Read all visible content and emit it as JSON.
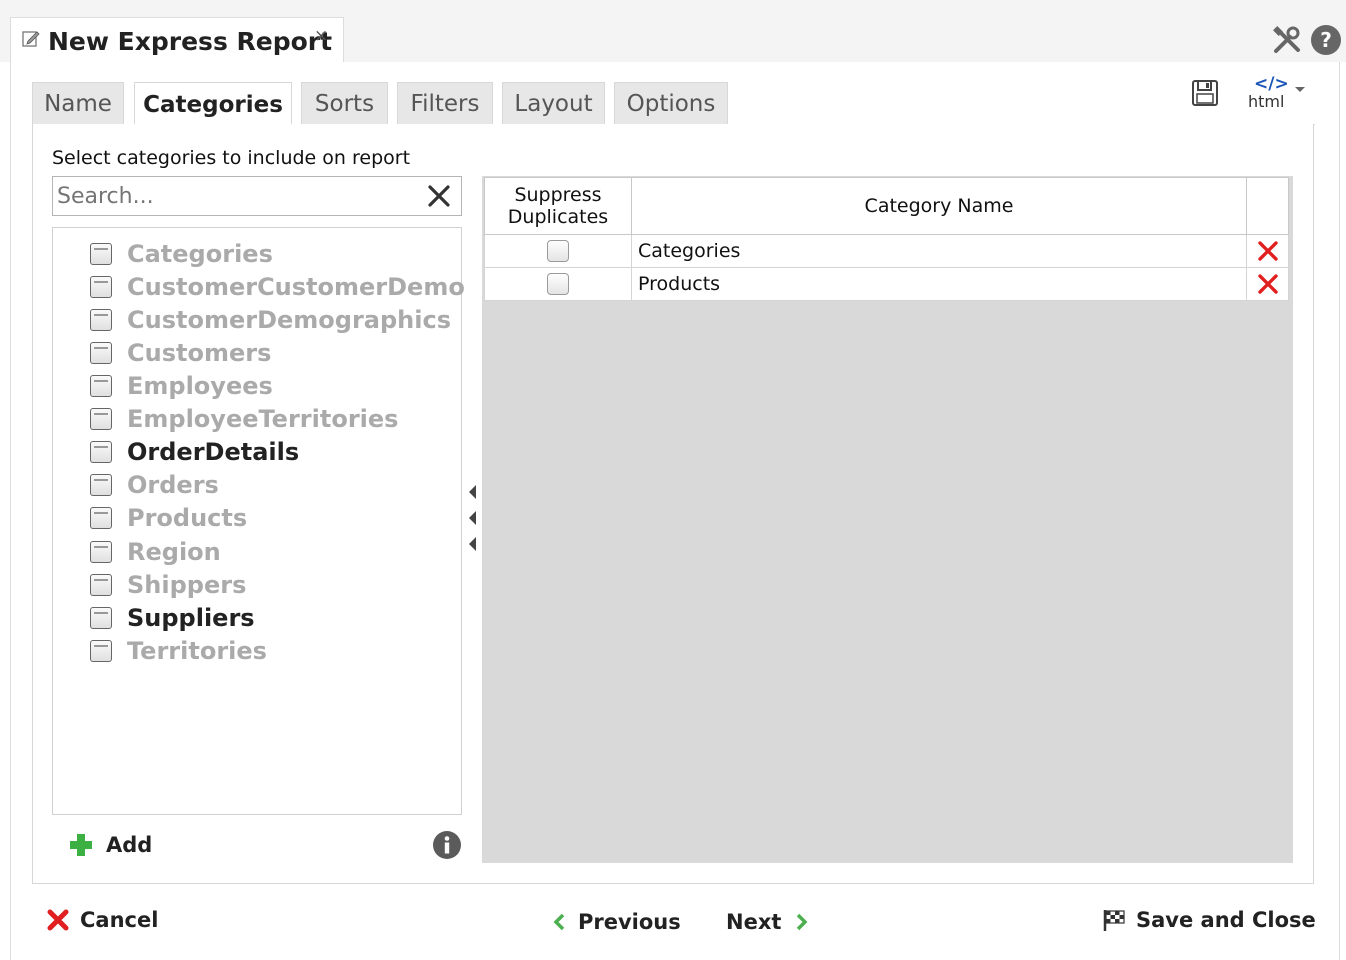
{
  "window": {
    "title": "New Express Report",
    "close_label": "×"
  },
  "tabs": [
    {
      "label": "Name"
    },
    {
      "label": "Categories"
    },
    {
      "label": "Sorts"
    },
    {
      "label": "Filters"
    },
    {
      "label": "Layout"
    },
    {
      "label": "Options"
    }
  ],
  "active_tab": "Categories",
  "toolbar": {
    "html_label": "html",
    "html_code_label": "</>"
  },
  "left": {
    "instructions": "Select categories to include on report",
    "search_placeholder": "Search...",
    "items": [
      {
        "label": "Categories",
        "emphasized": false
      },
      {
        "label": "CustomerCustomerDemo",
        "emphasized": false
      },
      {
        "label": "CustomerDemographics",
        "emphasized": false
      },
      {
        "label": "Customers",
        "emphasized": false
      },
      {
        "label": "Employees",
        "emphasized": false
      },
      {
        "label": "EmployeeTerritories",
        "emphasized": false
      },
      {
        "label": "OrderDetails",
        "emphasized": true
      },
      {
        "label": "Orders",
        "emphasized": false
      },
      {
        "label": "Products",
        "emphasized": false
      },
      {
        "label": "Region",
        "emphasized": false
      },
      {
        "label": "Shippers",
        "emphasized": false
      },
      {
        "label": "Suppliers",
        "emphasized": true
      },
      {
        "label": "Territories",
        "emphasized": false
      }
    ],
    "add_label": "Add"
  },
  "grid": {
    "headers": {
      "suppress_line1": "Suppress",
      "suppress_line2": "Duplicates",
      "category_name": "Category Name"
    },
    "rows": [
      {
        "name": "Categories",
        "suppress": false
      },
      {
        "name": "Products",
        "suppress": false
      }
    ]
  },
  "footer": {
    "cancel": "Cancel",
    "previous": "Previous",
    "next": "Next",
    "save_close": "Save and Close"
  },
  "colors": {
    "delete_red": "#e02020",
    "add_green": "#3cb043",
    "nav_green": "#4caf50"
  }
}
